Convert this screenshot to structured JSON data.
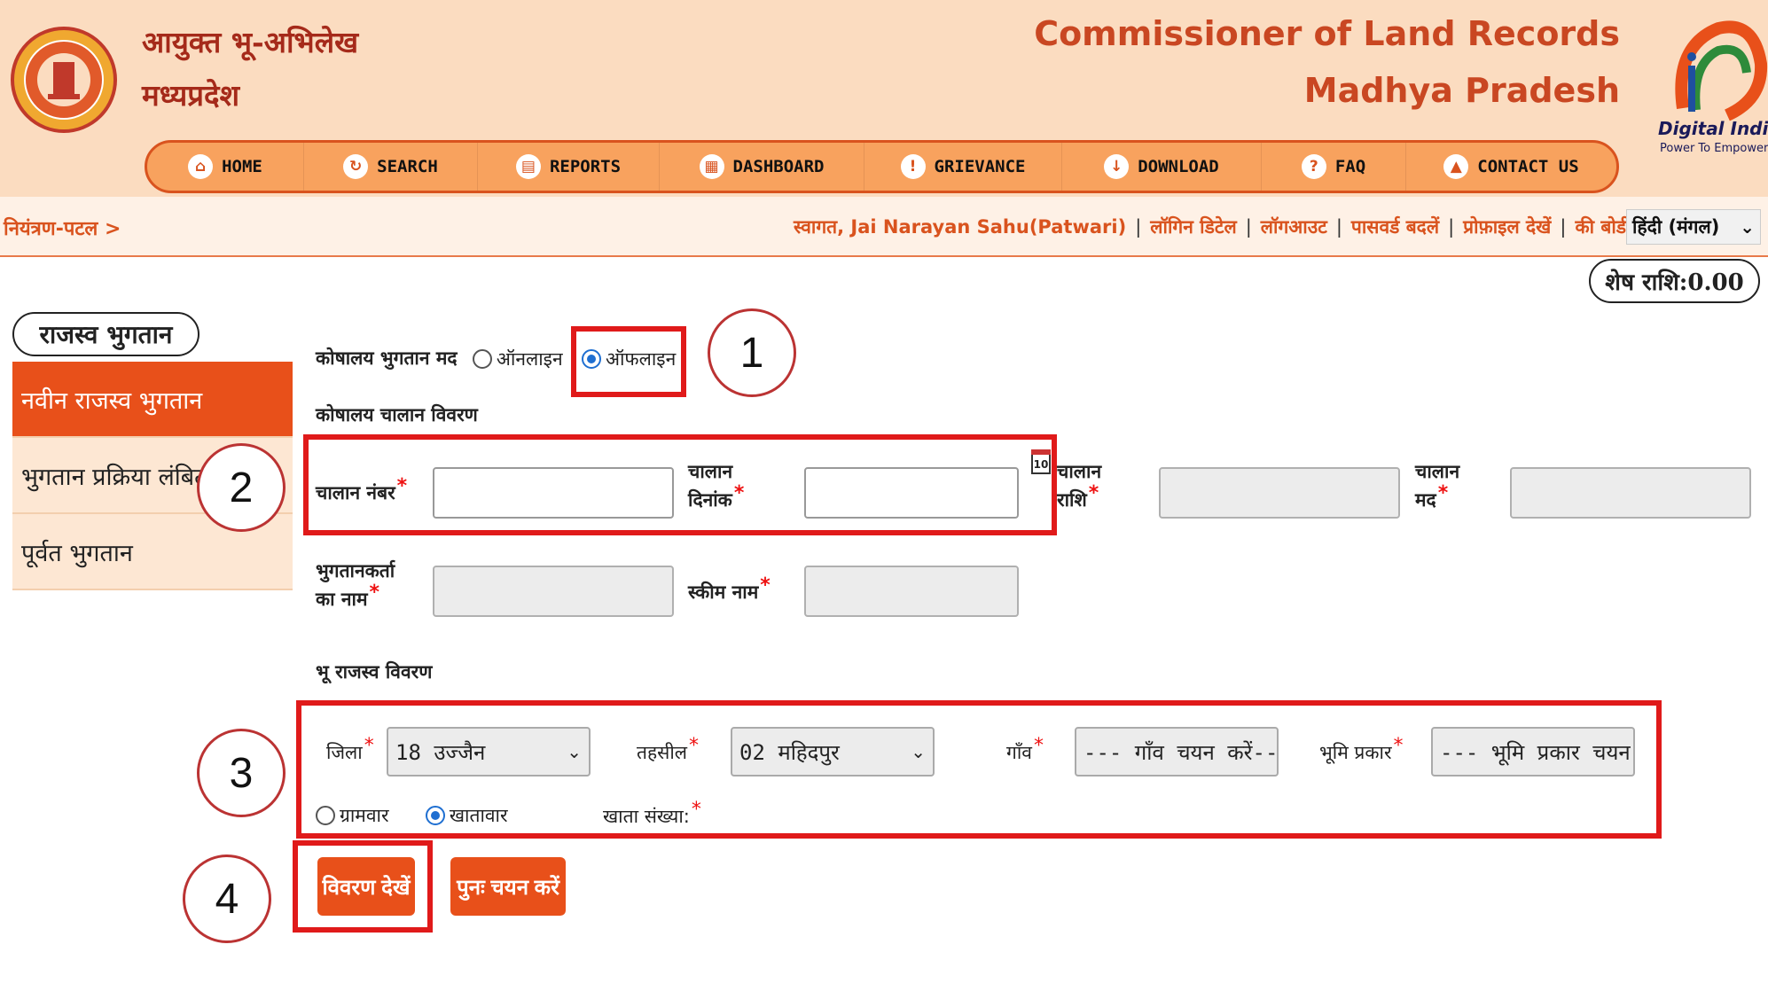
{
  "header": {
    "hi_title_line1": "आयुक्त भू-अभिलेख",
    "hi_title_line2": "मध्यप्रदेश",
    "en_title_line1": "Commissioner of Land Records",
    "en_title_line2": "Madhya Pradesh",
    "logo_text": "Digital India",
    "logo_tagline": "Power To Empower"
  },
  "nav": [
    {
      "label": "HOME",
      "icon": "home-icon",
      "glyph": "⌂"
    },
    {
      "label": "SEARCH",
      "icon": "search-icon",
      "glyph": "↻"
    },
    {
      "label": "REPORTS",
      "icon": "report-icon",
      "glyph": "▤"
    },
    {
      "label": "DASHBOARD",
      "icon": "dashboard-icon",
      "glyph": "▦"
    },
    {
      "label": "GRIEVANCE",
      "icon": "grievance-icon",
      "glyph": "!"
    },
    {
      "label": "DOWNLOAD",
      "icon": "download-icon",
      "glyph": "↓"
    },
    {
      "label": "FAQ",
      "icon": "faq-icon",
      "glyph": "?"
    },
    {
      "label": "CONTACT US",
      "icon": "contact-icon",
      "glyph": "▲"
    }
  ],
  "userbar": {
    "breadcrumb": "नियंत्रण-पटल >",
    "welcome": "स्वागत, Jai Narayan Sahu(Patwari)",
    "login_detail": "लॉगिन डिटेल",
    "logout": "लॉगआउट",
    "change_password": "पासवर्ड बदलें",
    "view_profile": "प्रोफ़ाइल देखें",
    "keyboard": "की बोर्ड",
    "language": "हिंदी (मंगल)"
  },
  "balance": "शेष राशि:0.00",
  "sidebar": {
    "title": "राजस्व भुगतान",
    "items": [
      {
        "label": "नवीन राजस्व भुगतान"
      },
      {
        "label": "भुगतान प्रक्रिया लंबित"
      },
      {
        "label": "पूर्वत भुगतान"
      }
    ]
  },
  "form": {
    "payment_head_label": "कोषालय भुगतान मद",
    "online_label": "ऑनलाइन",
    "offline_label": "ऑफलाइन",
    "payment_mode_selected": "offline",
    "challan_section": "कोषालय चालान विवरण",
    "challan_number_label": "चालान नंबर",
    "challan_date_label_1": "चालान",
    "challan_date_label_2": "दिनांक",
    "calendar_day": "10",
    "challan_amount_label_1": "चालान",
    "challan_amount_label_2": "राशि",
    "challan_head_label_1": "चालान",
    "challan_head_label_2": "मद",
    "payer_name_label_1": "भुगतानकर्ता",
    "payer_name_label_2": "का नाम",
    "scheme_name_label": "स्कीम नाम",
    "land_revenue_section": "भू राजस्व विवरण",
    "district_label": "जिला",
    "district_value": "18 उज्जैन",
    "tehsil_label": "तहसील",
    "tehsil_value": "02 महिदपुर",
    "village_label": "गाँव",
    "village_value": "--- गाँव चयन करें---",
    "land_type_label": "भूमि प्रकार",
    "land_type_value": "--- भूमि प्रकार चयन",
    "villagewise_label": "ग्रामवार",
    "accountwise_label": "खातावार",
    "search_mode_selected": "accountwise",
    "account_number_label": "खाता संख्या:",
    "view_button": "विवरण देखें",
    "reset_button": "पुनः चयन करें",
    "required_mark": "*"
  },
  "callouts": [
    "1",
    "2",
    "3",
    "4"
  ]
}
